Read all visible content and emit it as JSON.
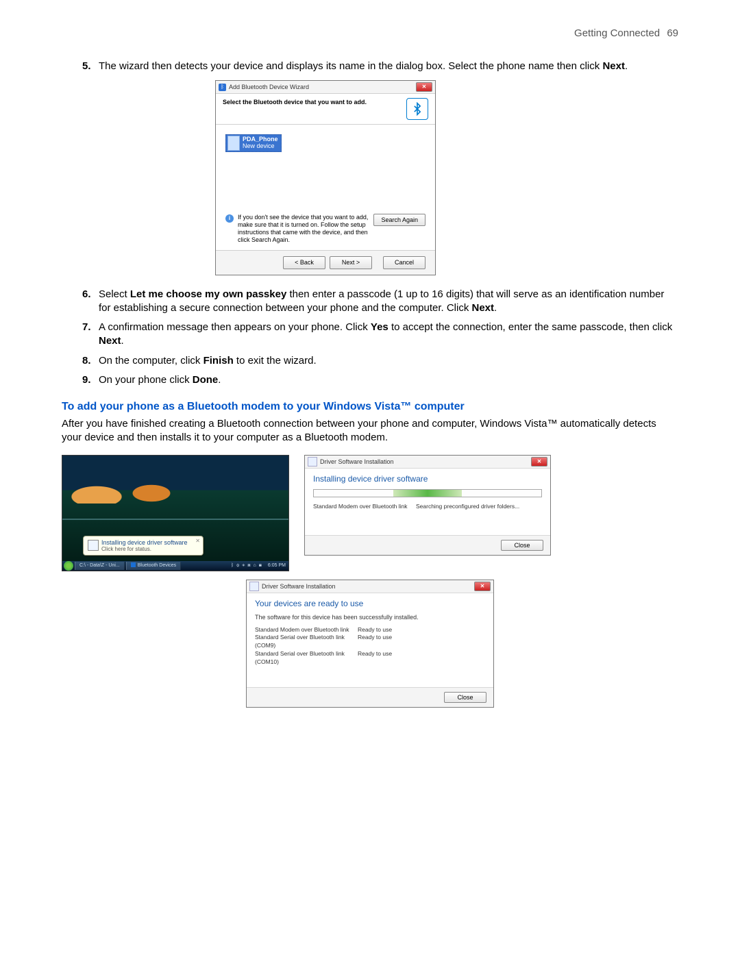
{
  "header": {
    "section": "Getting Connected",
    "page": "69"
  },
  "steps_a": {
    "s5": {
      "num": "5.",
      "p1": "The wizard then detects your device and displays its name in the dialog box. Select the phone name then click ",
      "b1": "Next",
      "p2": "."
    },
    "s6": {
      "num": "6.",
      "p1": "Select ",
      "b1": "Let me choose my own passkey",
      "p2": " then enter a passcode (1 up to 16 digits) that will serve as an identification number for establishing a secure connection between your phone and the computer. Click ",
      "b2": "Next",
      "p3": "."
    },
    "s7": {
      "num": "7.",
      "p1": "A confirmation message then appears on your phone. Click ",
      "b1": "Yes",
      "p2": " to accept the connection, enter the same passcode, then click ",
      "b2": "Next",
      "p3": "."
    },
    "s8": {
      "num": "8.",
      "p1": "On the computer, click ",
      "b1": "Finish",
      "p2": " to exit the wizard."
    },
    "s9": {
      "num": "9.",
      "p1": "On your phone click ",
      "b1": "Done",
      "p2": "."
    }
  },
  "wizard": {
    "title": "Add Bluetooth Device Wizard",
    "heading": "Select the Bluetooth device that you want to add.",
    "device_name": "PDA_Phone",
    "device_type": "New device",
    "info": "If you don't see the device that you want to add, make sure that it is turned on. Follow the setup instructions that came with the device, and then click Search Again.",
    "search_again": "Search Again",
    "back": "< Back",
    "next": "Next >",
    "cancel": "Cancel"
  },
  "section2": {
    "title": "To add your phone as a Bluetooth modem to your Windows Vista™ computer",
    "para": "After you have finished creating a Bluetooth connection between your phone and computer, Windows Vista™ automatically detects your device and then installs it to your computer as a Bluetooth modem."
  },
  "desktop": {
    "balloon_title": "Installing device driver software",
    "balloon_sub": "Click here for status.",
    "task1": "C:\\ - Data\\Z - Uni...",
    "task2": "Bluetooth Devices",
    "clock": "6:05 PM"
  },
  "driver1": {
    "title": "Driver Software Installation",
    "heading": "Installing device driver software",
    "row1c1": "Standard Modem over Bluetooth link",
    "row1c2": "Searching preconfigured driver folders...",
    "close": "Close"
  },
  "driver2": {
    "title": "Driver Software Installation",
    "heading": "Your devices are ready to use",
    "sub": "The software for this device has been successfully installed.",
    "r1c1": "Standard Modem over Bluetooth link",
    "r1c2": "Ready to use",
    "r2c1": "Standard Serial over Bluetooth link (COM9)",
    "r2c2": "Ready to use",
    "r3c1": "Standard Serial over Bluetooth link (COM10)",
    "r3c2": "Ready to use",
    "close": "Close"
  }
}
